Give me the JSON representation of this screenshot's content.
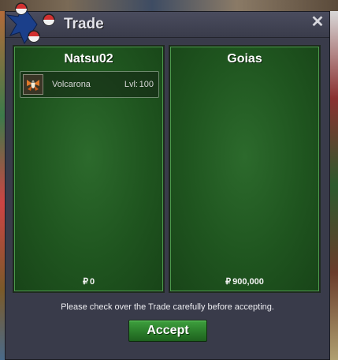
{
  "window": {
    "title": "Trade",
    "close_glyph": "✕"
  },
  "trade": {
    "left": {
      "player_name": "Natsu02",
      "items": [
        {
          "icon": "volcarona-sprite-icon",
          "name": "Volcarona",
          "level_label": "Lvl:",
          "level": "100"
        }
      ],
      "currency_symbol": "₽",
      "money": "0"
    },
    "right": {
      "player_name": "Goias",
      "items": [],
      "currency_symbol": "₽",
      "money": "900,000"
    }
  },
  "footer": {
    "notice": "Please check over the Trade carefully before accepting.",
    "accept_label": "Accept"
  },
  "colors": {
    "panel_green": "#1f551f",
    "accept_green": "#2b7d2b",
    "window_bg": "#393b4a"
  }
}
